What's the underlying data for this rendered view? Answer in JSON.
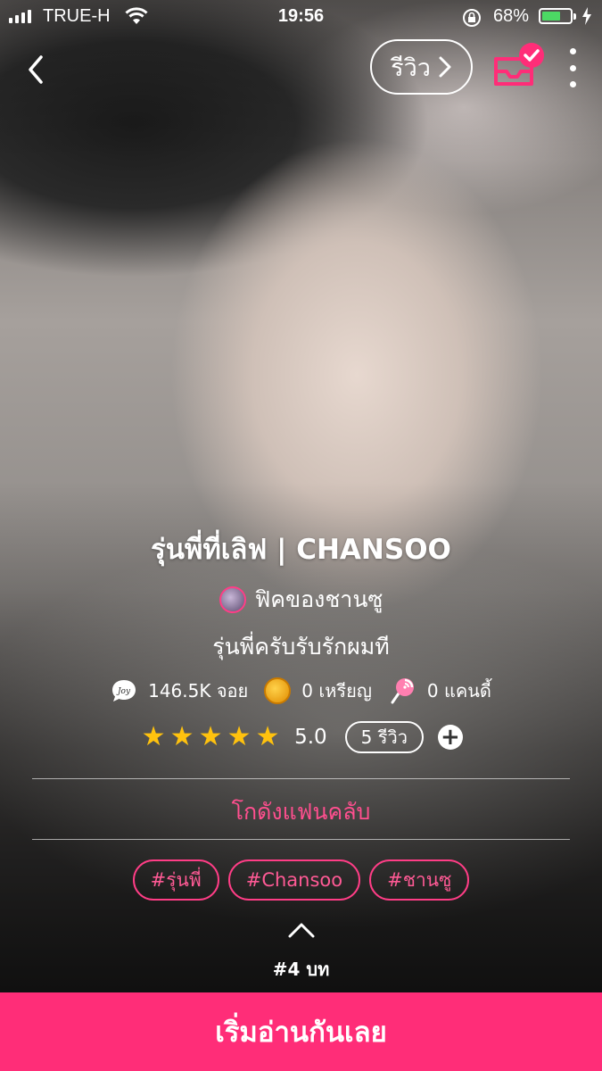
{
  "colors": {
    "accent": "#ff2d78",
    "star": "#ffc20e",
    "battery": "#4cd964"
  },
  "status_bar": {
    "carrier": "TRUE-H",
    "time": "19:56",
    "battery_percent": "68%",
    "battery_level": 0.68
  },
  "nav": {
    "review_label": "รีวิว"
  },
  "story": {
    "title": "รุ่นพี่ที่เลิฟ | CHANSOO",
    "author": "ฟิคของชานซู",
    "tagline": "รุ่นพี่ครับรับรักผมที"
  },
  "stats": {
    "joy": "146.5K จอย",
    "coins": "0 เหรียญ",
    "candy": "0 แคนดี้"
  },
  "rating": {
    "stars": 5,
    "value": "5.0",
    "review_count": "5 รีวิว"
  },
  "fanclub_label": "โกดังแฟนคลับ",
  "tags": [
    "#รุ่นพี่",
    "#Chansoo",
    "#ชานซู"
  ],
  "chapter_count": "#4 บท",
  "start_button_label": "เริ่มอ่านกันเลย"
}
